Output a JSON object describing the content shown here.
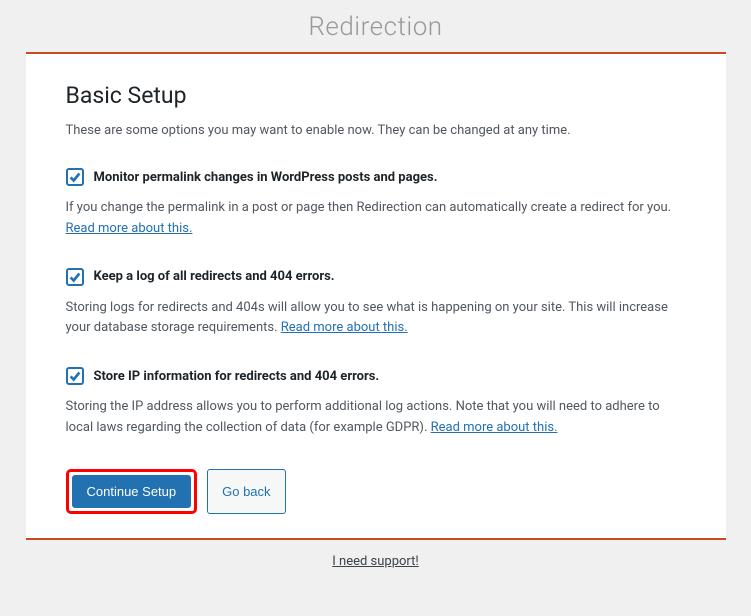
{
  "app_title": "Redirection",
  "heading": "Basic Setup",
  "intro": "These are some options you may want to enable now. They can be changed at any time.",
  "options": [
    {
      "checked": true,
      "label": "Monitor permalink changes in WordPress posts and pages.",
      "desc": "If you change the permalink in a post or page then Redirection can automatically create a redirect for you. ",
      "link_text": "Read more about this."
    },
    {
      "checked": true,
      "label": "Keep a log of all redirects and 404 errors.",
      "desc": "Storing logs for redirects and 404s will allow you to see what is happening on your site. This will increase your database storage requirements. ",
      "link_text": "Read more about this."
    },
    {
      "checked": true,
      "label": "Store IP information for redirects and 404 errors.",
      "desc": "Storing the IP address allows you to perform additional log actions. Note that you will need to adhere to local laws regarding the collection of data (for example GDPR). ",
      "link_text": "Read more about this."
    }
  ],
  "buttons": {
    "primary": "Continue Setup",
    "secondary": "Go back"
  },
  "footer": {
    "support_link": "I need support!"
  }
}
